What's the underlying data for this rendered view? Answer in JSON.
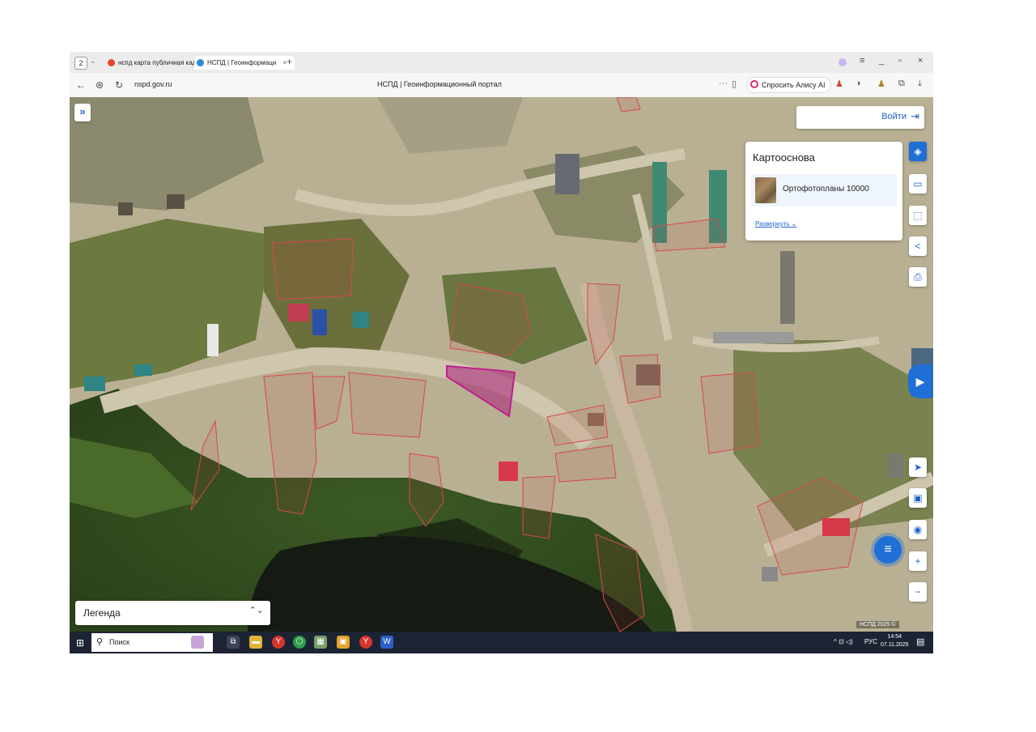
{
  "browser": {
    "tab_count": "2",
    "tabs": [
      {
        "label": "нспд карта публичная кад",
        "close": "×"
      },
      {
        "label": "НСПД | Геоинформаци",
        "close": "×"
      }
    ],
    "new_tab": "+",
    "window_controls": {
      "menu": "≡",
      "minimize": "_",
      "restore": "▫",
      "close": "×"
    },
    "nav": {
      "back": "←",
      "shield": "⊛",
      "reload": "↻"
    },
    "url": "nspd.gov.ru",
    "page_title": "НСПД | Геоинформационный портал",
    "more": "···",
    "alisa_label": "Спросить Алису AI",
    "download": "⤓"
  },
  "map": {
    "expand_label": "»",
    "login_label": "Войти",
    "login_icon": "⇥",
    "basemap_panel": {
      "title": "Картооснова",
      "item_label": "Ортофотопланы 10000",
      "expand_link": "Развернуть ⌄"
    },
    "tools": {
      "layers": "◈",
      "ruler": "▭",
      "select": "⬚",
      "share": "<",
      "print": "⎙",
      "locate": "➤",
      "screen": "▣",
      "pin": "◉",
      "zoom_in": "+",
      "zoom_out": "−"
    },
    "chat_icon": "≡",
    "side_icon": "▶",
    "legend_label": "Легенда",
    "legend_arrow": "⌃⌄",
    "copyright": "НСПД 2025 ©"
  },
  "taskbar": {
    "start": "⊞",
    "search_placeholder": "Поиск",
    "search_icon": "⚲",
    "tray_lang": "РУС",
    "tray_icons": "^ ⊡ ◁)",
    "time": "14:54",
    "date": "07.11.2025",
    "notif": "▤"
  },
  "colors": {
    "accent": "#1f6fd6",
    "parcel_border": "#d8484a",
    "selected_parcel": "#c0208c"
  }
}
